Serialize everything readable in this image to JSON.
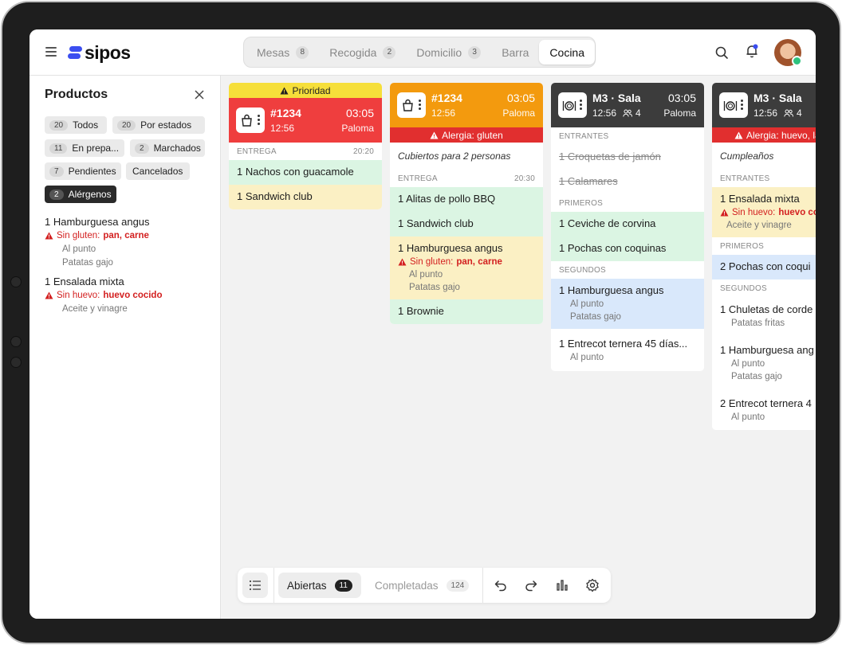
{
  "header": {
    "logo": "sipos",
    "tabs": [
      {
        "label": "Mesas",
        "count": "8"
      },
      {
        "label": "Recogida",
        "count": "2"
      },
      {
        "label": "Domicilio",
        "count": "3"
      },
      {
        "label": "Barra",
        "count": ""
      },
      {
        "label": "Cocina",
        "count": "",
        "active": true
      }
    ]
  },
  "sidebar": {
    "title": "Productos",
    "chips": [
      {
        "count": "20",
        "label": "Todos"
      },
      {
        "count": "20",
        "label": "Por estados"
      },
      {
        "count": "11",
        "label": "En prepa..."
      },
      {
        "count": "2",
        "label": "Marchados"
      },
      {
        "count": "7",
        "label": "Pendientes"
      },
      {
        "count": "",
        "label": "Cancelados"
      },
      {
        "count": "2",
        "label": "Alérgenos",
        "active": true
      }
    ],
    "items": [
      {
        "name": "1  Hamburguesa angus",
        "alert": "Sin gluten:",
        "alert_items": "pan, carne",
        "mods": [
          "Al punto",
          "Patatas gajo"
        ]
      },
      {
        "name": "1  Ensalada mixta",
        "alert": "Sin huevo:",
        "alert_items": "huevo cocido",
        "mods": [
          "Aceite y vinagre"
        ]
      }
    ]
  },
  "cards": [
    {
      "priority": "Prioridad",
      "number": "#1234",
      "time": "03:05",
      "opened": "12:56",
      "waiter": "Paloma",
      "section_label": "ENTREGA",
      "section_time": "20:20",
      "lines": [
        "1  Nachos con guacamole",
        "1  Sandwich club"
      ]
    },
    {
      "number": "#1234",
      "time": "03:05",
      "opened": "12:56",
      "waiter": "Paloma",
      "allergy": "Alergia: gluten",
      "note": "Cubiertos para 2 personas",
      "section_label": "ENTREGA",
      "section_time": "20:30",
      "lines": [
        "1  Alitas de pollo BBQ",
        "1  Sandwich club",
        "1  Hamburguesa angus",
        "1  Brownie"
      ],
      "burger_alert": "Sin gluten:",
      "burger_alert_items": "pan, carne",
      "burger_mods": [
        "Al punto",
        "Patatas gajo"
      ]
    },
    {
      "number": "M3 · Sala",
      "time": "03:05",
      "opened": "12:56",
      "guests": "4",
      "waiter": "Paloma",
      "sections": [
        "ENTRANTES",
        "PRIMEROS",
        "SEGUNDOS"
      ],
      "entrantes": [
        "1  Croquetas de jamón",
        "1  Calamares"
      ],
      "primeros": [
        "1  Ceviche de corvina",
        "1  Pochas con coquinas"
      ],
      "segundos": [
        "1  Hamburguesa angus",
        "1  Entrecot ternera 45 días..."
      ],
      "burger_mods": [
        "Al punto",
        "Patatas gajo"
      ],
      "entrecot_mods": [
        "Al punto"
      ]
    },
    {
      "number": "M3 · Sala",
      "opened": "12:56",
      "guests": "4",
      "allergy": "Alergia: huevo, la",
      "note": "Cumpleaños",
      "sections": [
        "ENTRANTES",
        "PRIMEROS",
        "SEGUNDOS"
      ],
      "entrantes": [
        "1  Ensalada mixta"
      ],
      "salad_alert": "Sin huevo:",
      "salad_alert_items": "huevo co",
      "salad_mods": [
        "Aceite y vinagre"
      ],
      "primeros": [
        "2  Pochas con coqui"
      ],
      "segundos": [
        "1  Chuletas de corde",
        "1  Hamburguesa ang",
        "2  Entrecot ternera 4"
      ],
      "chuletas_mods": [
        "Patatas fritas"
      ],
      "burger_mods": [
        "Al punto",
        "Patatas gajo"
      ],
      "entrecot_mods": [
        "Al punto"
      ]
    }
  ],
  "bottom": {
    "open_label": "Abiertas",
    "open_count": "11",
    "done_label": "Completadas",
    "done_count": "124"
  },
  "colors": {
    "accent": "#3b4ef0",
    "priority": "#f6df3a",
    "red": "#ef3e3e",
    "orange": "#f39a0e",
    "dark": "#3c3c3c",
    "alert": "#e12f2f"
  }
}
